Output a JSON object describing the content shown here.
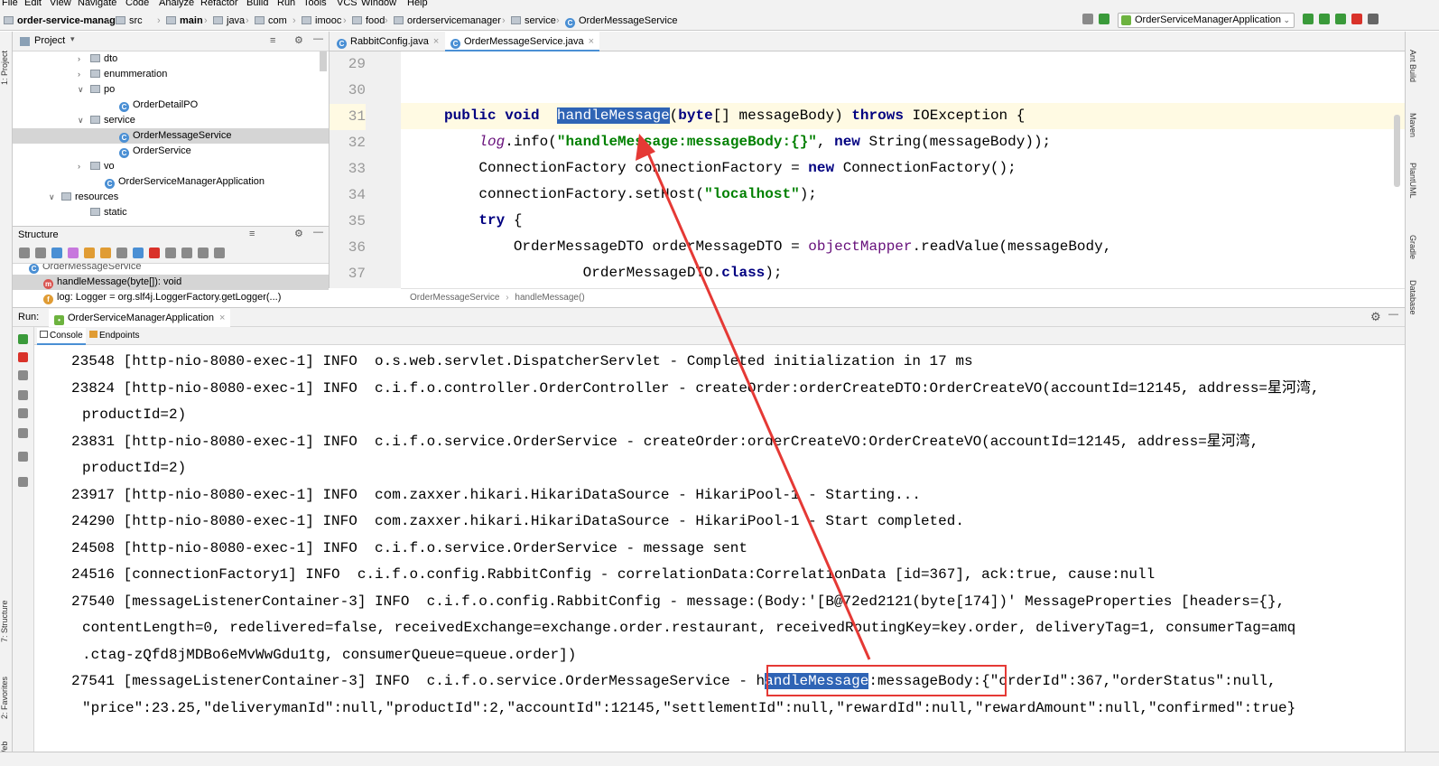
{
  "menu": [
    "File",
    "Edit",
    "View",
    "Navigate",
    "Code",
    "Analyze",
    "Refactor",
    "Build",
    "Run",
    "Tools",
    "VCS",
    "Window",
    "Help"
  ],
  "breadcrumbs": [
    "order-service-manager",
    "src",
    "main",
    "java",
    "com",
    "imooc",
    "food",
    "orderservicemanager",
    "service",
    "OrderMessageService"
  ],
  "run_config": "OrderServiceManagerApplication",
  "project_panel": {
    "title": "Project"
  },
  "tree": [
    {
      "label": "dto",
      "type": "folder",
      "expand": ">"
    },
    {
      "label": "enummeration",
      "type": "folder",
      "expand": ">"
    },
    {
      "label": "po",
      "type": "folder",
      "expand": "v"
    },
    {
      "label": "OrderDetailPO",
      "type": "class",
      "expand": ""
    },
    {
      "label": "service",
      "type": "folder",
      "expand": "v"
    },
    {
      "label": "OrderMessageService",
      "type": "class",
      "expand": "",
      "selected": true
    },
    {
      "label": "OrderService",
      "type": "class",
      "expand": ""
    },
    {
      "label": "vo",
      "type": "folder",
      "expand": ">"
    },
    {
      "label": "OrderServiceManagerApplication",
      "type": "class",
      "expand": ""
    },
    {
      "label": "resources",
      "type": "folder",
      "expand": "v"
    },
    {
      "label": "static",
      "type": "folder",
      "expand": ""
    }
  ],
  "structure": {
    "title": "Structure",
    "items": [
      "OrderMessageService",
      "handleMessage(byte[]): void",
      "log: Logger = org.slf4j.LoggerFactory.getLogger(...)"
    ]
  },
  "editor_tabs": [
    {
      "label": "RabbitConfig.java",
      "active": false
    },
    {
      "label": "OrderMessageService.java",
      "active": true
    }
  ],
  "code": {
    "line_numbers": [
      "29",
      "30",
      "31",
      "32",
      "33",
      "34",
      "35",
      "36",
      "37"
    ],
    "current_line": 31
  },
  "editor_breadcrumbs": [
    "OrderMessageService",
    "handleMessage()"
  ],
  "run": {
    "label": "Run:",
    "config": "OrderServiceManagerApplication",
    "tabs": [
      "Console",
      "Endpoints"
    ]
  },
  "console_lines": [
    {
      "text": "23548 [http-nio-8080-exec-1] INFO  o.s.web.servlet.DispatcherServlet - Completed initialization in 17 ms",
      "cont": false
    },
    {
      "text": "23824 [http-nio-8080-exec-1] INFO  c.i.f.o.controller.OrderController - createOrder:orderCreateDTO:OrderCreateVO(accountId=12145, address=星河湾,",
      "cont": false
    },
    {
      "text": "productId=2)",
      "cont": true
    },
    {
      "text": "23831 [http-nio-8080-exec-1] INFO  c.i.f.o.service.OrderService - createOrder:orderCreateVO:OrderCreateVO(accountId=12145, address=星河湾,",
      "cont": false
    },
    {
      "text": "productId=2)",
      "cont": true
    },
    {
      "text": "23917 [http-nio-8080-exec-1] INFO  com.zaxxer.hikari.HikariDataSource - HikariPool-1 - Starting...",
      "cont": false
    },
    {
      "text": "24290 [http-nio-8080-exec-1] INFO  com.zaxxer.hikari.HikariDataSource - HikariPool-1 - Start completed.",
      "cont": false
    },
    {
      "text": "24508 [http-nio-8080-exec-1] INFO  c.i.f.o.service.OrderService - message sent",
      "cont": false
    },
    {
      "text": "24516 [connectionFactory1] INFO  c.i.f.o.config.RabbitConfig - correlationData:CorrelationData [id=367], ack:true, cause:null",
      "cont": false
    },
    {
      "text": "27540 [messageListenerContainer-3] INFO  c.i.f.o.config.RabbitConfig - message:(Body:'[B@72ed2121(byte[174])' MessageProperties [headers={},",
      "cont": false
    },
    {
      "text": "contentLength=0, redelivered=false, receivedExchange=exchange.order.restaurant, receivedRoutingKey=key.order, deliveryTag=1, consumerTag=amq",
      "cont": true
    },
    {
      "text": ".ctag-zQfd8jMDBo6eMvWwGdu1tg, consumerQueue=queue.order])",
      "cont": true
    },
    {
      "text": "27541 [messageListenerContainer-3] INFO  c.i.f.o.service.OrderMessageService - handleMessage:messageBody:{\"orderId\":367,\"orderStatus\":null,",
      "cont": false
    },
    {
      "text": "\"price\":23.25,\"deliverymanId\":null,\"productId\":2,\"accountId\":12145,\"settlementId\":null,\"rewardId\":null,\"rewardAmount\":null,\"confirmed\":true}",
      "cont": true
    }
  ],
  "side_tool_windows_left": [
    "1: Project",
    "7: Structure",
    "2: Favorites",
    "Web"
  ],
  "side_tool_windows_right": [
    "Ant Build",
    "Maven",
    "PlantUML",
    "Gradle",
    "Database"
  ],
  "colors": {
    "accent": "#4a8fd4",
    "selection": "#2f64b5",
    "annotation": "#e53935"
  }
}
